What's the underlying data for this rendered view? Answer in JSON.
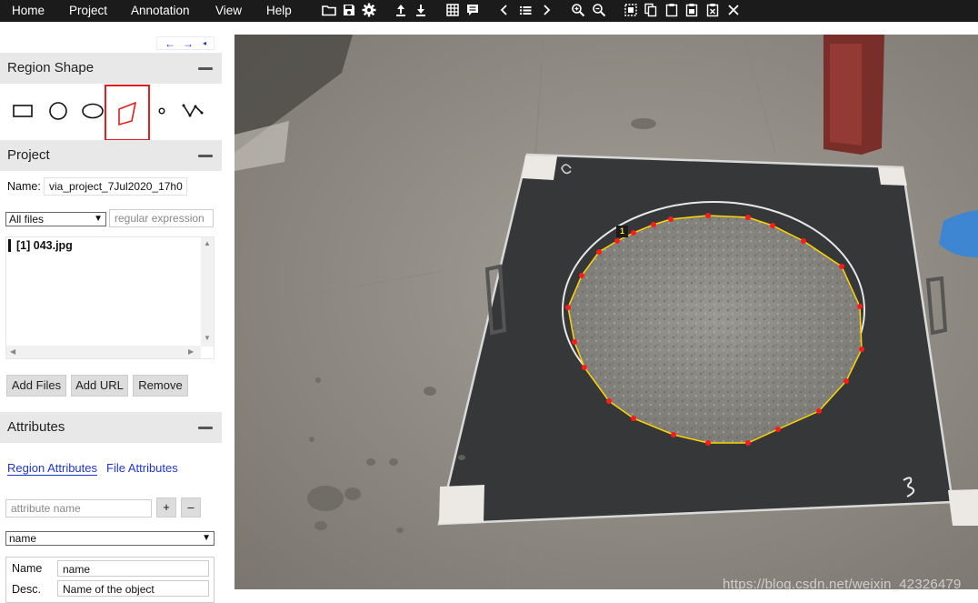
{
  "menubar": {
    "items": [
      "Home",
      "Project",
      "Annotation",
      "View",
      "Help"
    ]
  },
  "toolbar": {
    "icons": [
      "open-folder-icon",
      "save-icon",
      "settings-icon",
      "upload-icon",
      "download-icon",
      "grid-icon",
      "comment-icon",
      "chevron-left-icon",
      "list-icon",
      "chevron-right-icon",
      "zoom-in-icon",
      "zoom-out-icon",
      "select-all-icon",
      "copy-icon",
      "paste-icon",
      "paste-region-icon",
      "delete-icon",
      "close-icon"
    ]
  },
  "left_panel": {
    "nav": {
      "prev": "←",
      "next": "→",
      "collapse": "◂"
    },
    "region_shape": {
      "title": "Region Shape",
      "shapes": [
        "rectangle",
        "circle",
        "ellipse",
        "polygon",
        "point",
        "polyline"
      ],
      "selected": "polygon"
    },
    "project": {
      "title": "Project",
      "name_label": "Name:",
      "name_value": "via_project_7Jul2020_17h0",
      "filter_select": "All files",
      "regex_placeholder": "regular expression",
      "files": [
        {
          "label": "[1] 043.jpg"
        }
      ],
      "buttons": {
        "add_files": "Add Files",
        "add_url": "Add URL",
        "remove": "Remove"
      }
    },
    "attributes": {
      "title": "Attributes",
      "tabs": {
        "region": "Region Attributes",
        "file": "File Attributes"
      },
      "active_tab": "region",
      "attr_name_placeholder": "attribute name",
      "add": "+",
      "remove": "–",
      "attr_select": "name",
      "detail": {
        "name_label": "Name",
        "name_value": "name",
        "desc_label": "Desc.",
        "desc_value": "Name of the object"
      }
    }
  },
  "image": {
    "filename": "043.jpg",
    "region_id": "1",
    "region_color": "#ffd400",
    "vertex_color": "#ff1a1a",
    "watermark": "https://blog.csdn.net/weixin_42326479"
  }
}
